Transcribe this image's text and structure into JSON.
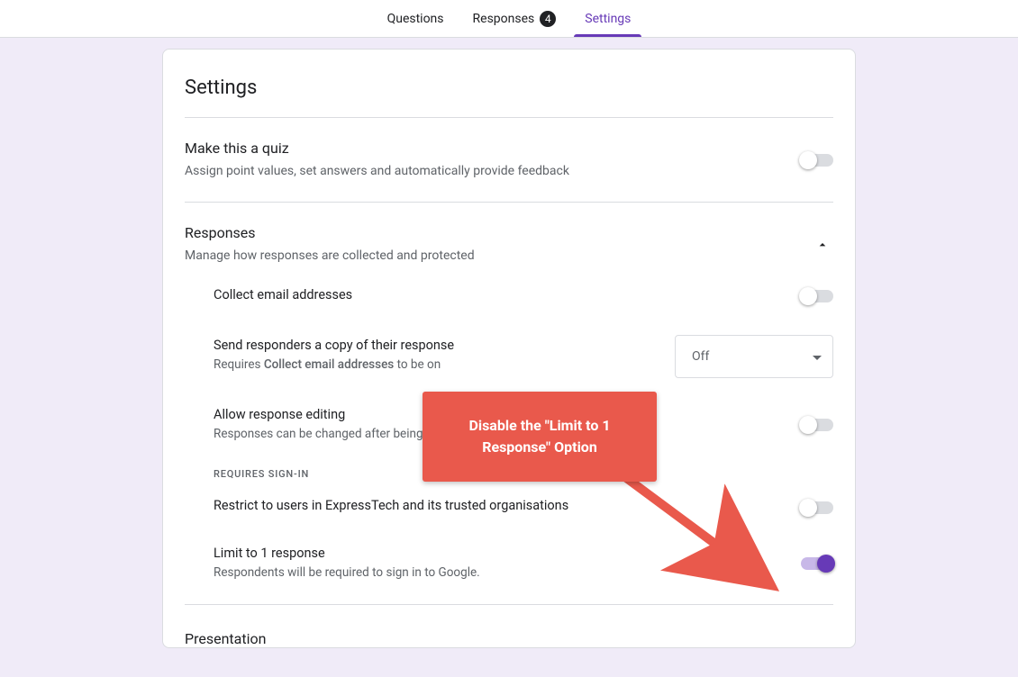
{
  "tabs": {
    "questions": "Questions",
    "responses_label": "Responses",
    "responses_count": "4",
    "settings": "Settings"
  },
  "panel": {
    "title": "Settings",
    "quiz": {
      "heading": "Make this a quiz",
      "desc": "Assign point values, set answers and automatically provide feedback"
    },
    "responses": {
      "heading": "Responses",
      "desc": "Manage how responses are collected and protected",
      "collect_email": "Collect email addresses",
      "send_copy_heading": "Send responders a copy of their response",
      "send_copy_desc_prefix": "Requires ",
      "send_copy_desc_strong": "Collect email addresses",
      "send_copy_desc_suffix": " to be on",
      "send_copy_value": "Off",
      "allow_edit_heading": "Allow response editing",
      "allow_edit_desc": "Responses can be changed after being submitted",
      "requires_signin_label": "REQUIRES SIGN-IN",
      "restrict_heading": "Restrict to users in ExpressTech and its trusted organisations",
      "limit_heading": "Limit to 1 response",
      "limit_desc": "Respondents will be required to sign in to Google."
    },
    "presentation_heading": "Presentation"
  },
  "callout": {
    "text": "Disable the \"Limit to 1 Response\" Option"
  }
}
